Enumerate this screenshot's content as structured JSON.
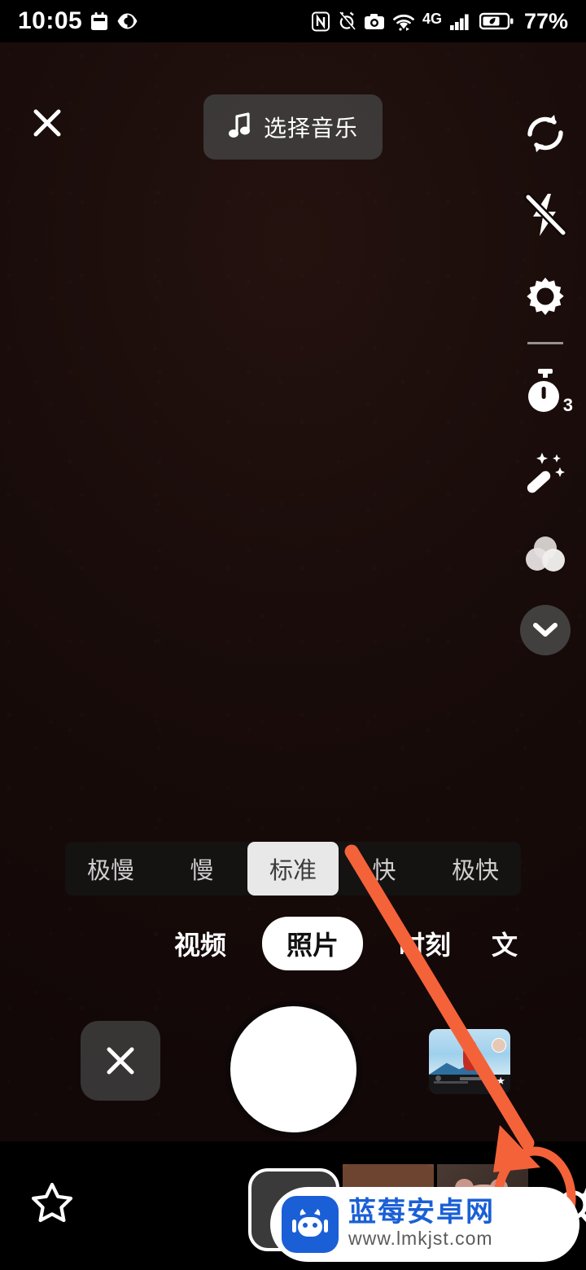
{
  "status_bar": {
    "time": "10:05",
    "battery_percent": "77%",
    "network_type": "4G",
    "left_icons": [
      "calendar-icon",
      "eye-comfort-icon"
    ],
    "right_icons": [
      "nfc-icon",
      "alarm-muted-icon",
      "camera-icon",
      "wifi-icon",
      "signal-bars-icon",
      "battery-saver-icon"
    ]
  },
  "topbar": {
    "close_label": "×",
    "music_label": "选择音乐",
    "music_icon": "music-note-icon"
  },
  "right_rail": {
    "items": [
      {
        "name": "flip-camera-icon",
        "label": ""
      },
      {
        "name": "flash-off-icon",
        "label": ""
      },
      {
        "name": "settings-gear-icon",
        "label": ""
      },
      {
        "name": "timer-icon",
        "label": "3"
      },
      {
        "name": "beauty-wand-icon",
        "label": ""
      },
      {
        "name": "filter-circles-icon",
        "label": ""
      },
      {
        "name": "collapse-chevron-down-icon",
        "label": ""
      }
    ],
    "timer_value": "3"
  },
  "speed_bar": {
    "options": [
      "极慢",
      "慢",
      "标准",
      "快",
      "极快"
    ],
    "selected": "标准",
    "selected_index": 2
  },
  "mode_tabs": {
    "items": [
      "视频",
      "照片",
      "时刻",
      "文"
    ],
    "selected": "照片",
    "selected_index": 1
  },
  "shutter_row": {
    "cancel_label": "×",
    "shutter_name": "shutter-button",
    "gallery_name": "gallery-thumbnail"
  },
  "effects_bar": {
    "favorites_icon": "star-outline-icon",
    "items": [
      {
        "name": "effect-none",
        "label": ""
      },
      {
        "name": "effect-girl-face",
        "label": ""
      },
      {
        "name": "effect-pig-face",
        "label": ""
      },
      {
        "name": "effect-search",
        "label": ""
      }
    ],
    "search_icon": "magnifier-sparkle-icon"
  },
  "annotation": {
    "highlight_color": "#f4623a",
    "arrow_name": "annotation-arrow",
    "circle_name": "annotation-ellipse",
    "target": "magnifier-sparkle-icon"
  },
  "watermark": {
    "site_name": "蓝莓安卓网",
    "url": "www.lmkjst.com",
    "logo_color": "#1a5fd6"
  }
}
